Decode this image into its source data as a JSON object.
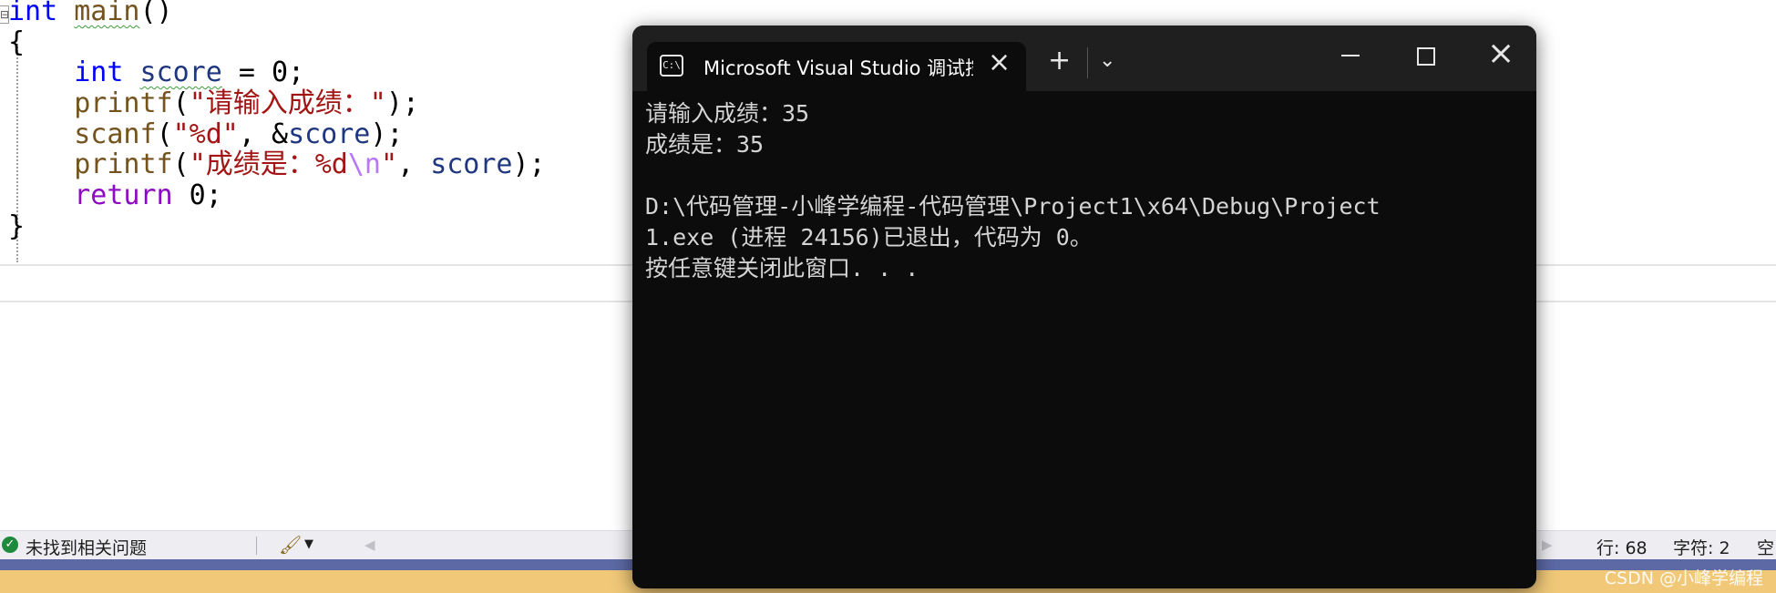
{
  "editor": {
    "lines": [
      {
        "parts": [
          {
            "text": "int",
            "cls": "kw"
          },
          {
            "text": " "
          },
          {
            "text": "main",
            "cls": "fn squiggle"
          },
          {
            "text": "()"
          }
        ]
      },
      {
        "parts": [
          {
            "text": "{"
          }
        ]
      },
      {
        "parts": [
          {
            "text": "    "
          },
          {
            "text": "int",
            "cls": "kw"
          },
          {
            "text": " "
          },
          {
            "text": "score",
            "cls": "ident squiggle"
          },
          {
            "text": " = 0;"
          }
        ]
      },
      {
        "parts": [
          {
            "text": "    "
          },
          {
            "text": "printf",
            "cls": "fn"
          },
          {
            "text": "("
          },
          {
            "text": "\"请输入成绩：\"",
            "cls": "str"
          },
          {
            "text": ");"
          }
        ]
      },
      {
        "parts": [
          {
            "text": "    "
          },
          {
            "text": "scanf",
            "cls": "fn"
          },
          {
            "text": "("
          },
          {
            "text": "\"%d\"",
            "cls": "str"
          },
          {
            "text": ", &"
          },
          {
            "text": "score",
            "cls": "ident"
          },
          {
            "text": ");"
          }
        ]
      },
      {
        "parts": [
          {
            "text": "    "
          },
          {
            "text": "printf",
            "cls": "fn"
          },
          {
            "text": "("
          },
          {
            "text": "\"成绩是：%d",
            "cls": "str"
          },
          {
            "text": "\\n",
            "cls": "esc"
          },
          {
            "text": "\"",
            "cls": "str"
          },
          {
            "text": ", "
          },
          {
            "text": "score",
            "cls": "ident"
          },
          {
            "text": ");"
          }
        ]
      },
      {
        "parts": [
          {
            "text": "    "
          },
          {
            "text": "return",
            "cls": "ret"
          },
          {
            "text": " 0;"
          }
        ]
      },
      {
        "parts": [
          {
            "text": "}"
          }
        ]
      }
    ]
  },
  "statusbar": {
    "issues_text": "未找到相关问题",
    "line": "行: 68",
    "char": "字符: 2",
    "mode": "空"
  },
  "console": {
    "tab_title": "Microsoft Visual Studio 调试控制台",
    "icon_text": "C:\\",
    "lines": [
      "请输入成绩：35",
      "成绩是：35",
      "",
      "D:\\代码管理-小峰学编程-代码管理\\Project1\\x64\\Debug\\Project",
      "1.exe (进程 24156)已退出，代码为 0。",
      "按任意键关闭此窗口. . ."
    ]
  },
  "watermark": "CSDN @小峰学编程",
  "colors": {
    "keyword": "#0000ff",
    "string": "#a31515",
    "function": "#74531f",
    "identifier": "#1f377f",
    "return_keyword": "#8f08c4",
    "console_bg": "#0c0c0c",
    "titlebar_bg": "#1f1f1f",
    "status_ok": "#1e8a3c"
  }
}
